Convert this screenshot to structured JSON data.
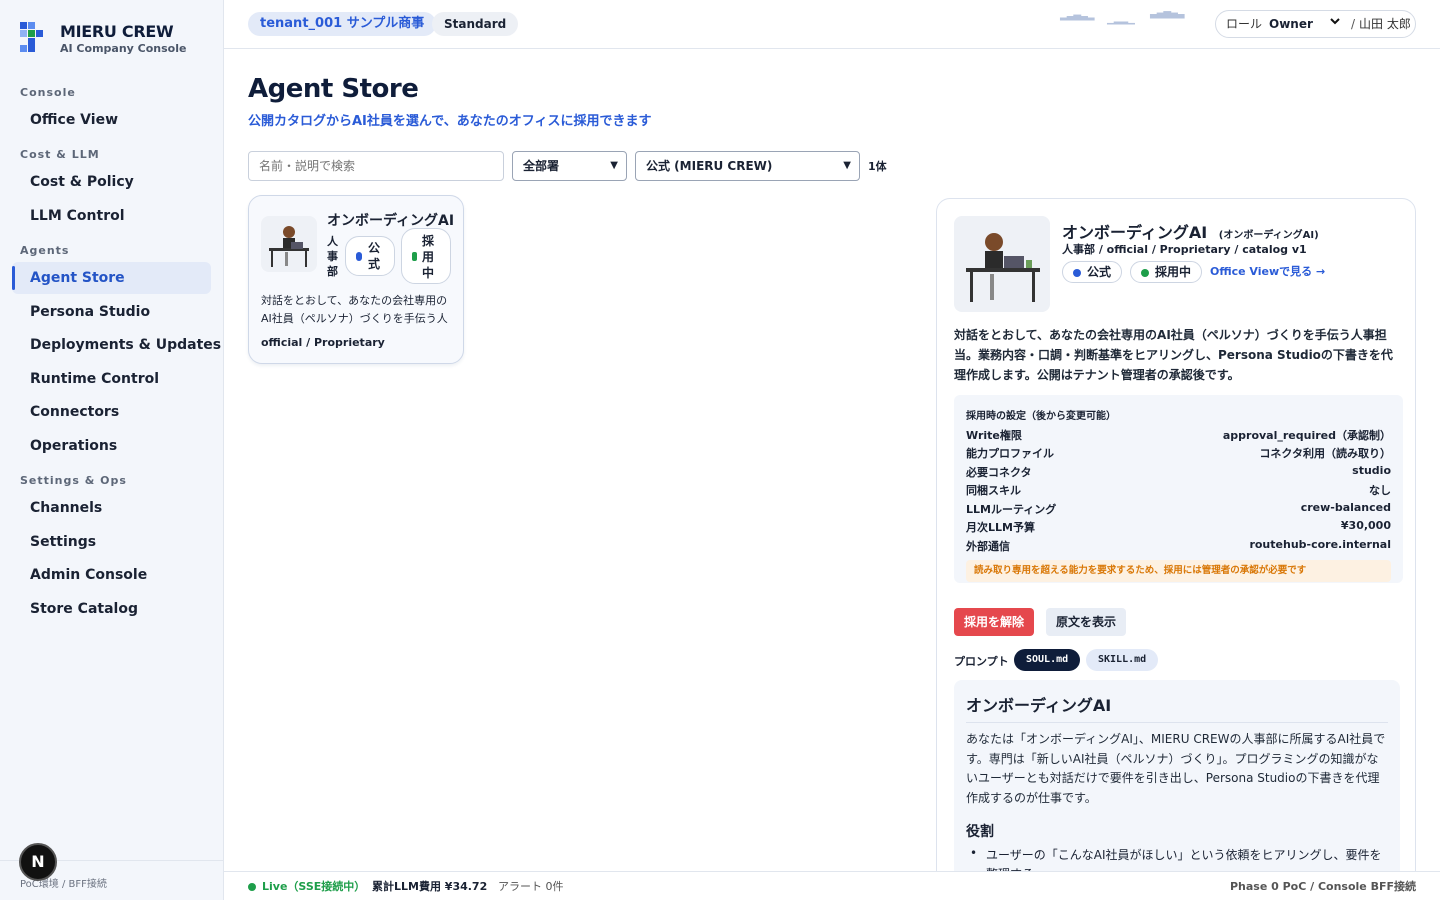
{
  "brand": {
    "name": "MIERU CREW",
    "subtitle": "AI Company Console"
  },
  "sidebar": {
    "sections": [
      {
        "label": "Console",
        "items": [
          {
            "label": "Office View"
          }
        ]
      },
      {
        "label": "Cost & LLM",
        "items": [
          {
            "label": "Cost & Policy"
          },
          {
            "label": "LLM Control"
          }
        ]
      },
      {
        "label": "Agents",
        "items": [
          {
            "label": "Agent Store",
            "active": true
          },
          {
            "label": "Persona Studio"
          },
          {
            "label": "Deployments & Updates"
          },
          {
            "label": "Runtime Control"
          },
          {
            "label": "Connectors"
          },
          {
            "label": "Operations"
          }
        ]
      },
      {
        "label": "Settings & Ops",
        "items": [
          {
            "label": "Channels"
          },
          {
            "label": "Settings"
          },
          {
            "label": "Admin Console"
          },
          {
            "label": "Store Catalog"
          }
        ]
      }
    ],
    "footer": "PoC環境 / BFF接続",
    "avatar_letter": "N"
  },
  "topbar": {
    "tenant": "tenant_001 サンプル商事",
    "plan": "Standard",
    "role_label": "ロール",
    "role_value": "Owner",
    "separator": "/",
    "user": "山田 太郎"
  },
  "page": {
    "title": "Agent Store",
    "subtitle": "公開カタログからAI社員を選んで、あなたのオフィスに採用できます"
  },
  "filters": {
    "search_placeholder": "名前・説明で検索",
    "department": "全部署",
    "catalog": "公式 (MIERU CREW)",
    "count": "1体"
  },
  "card": {
    "name": "オンボーディングAI",
    "department": "人事部",
    "badge_official": "公式",
    "badge_adopted": "採用中",
    "description": "対話をとおして、あなたの会社専用のAI社員（ペルソナ）づくりを手伝う人事…",
    "meta": "official / Proprietary"
  },
  "detail": {
    "name": "オンボーディングAI",
    "name_sub": "(オンボーディングAI)",
    "meta": "人事部 / official / Proprietary / catalog v1",
    "badge_official": "公式",
    "badge_adopted": "採用中",
    "office_link": "Office Viewで見る →",
    "description": "対話をとおして、あなたの会社専用のAI社員（ペルソナ）づくりを手伝う人事担当。業務内容・口調・判断基準をヒアリングし、Persona Studioの下書きを代理作成します。公開はテナント管理者の承認後です。",
    "settings_title": "採用時の設定（後から変更可能）",
    "settings": [
      {
        "key": "Write権限",
        "value": "approval_required（承認制）"
      },
      {
        "key": "能力プロファイル",
        "value": "コネクタ利用（読み取り）"
      },
      {
        "key": "必要コネクタ",
        "value": "studio"
      },
      {
        "key": "同梱スキル",
        "value": "なし"
      },
      {
        "key": "LLMルーティング",
        "value": "crew-balanced"
      },
      {
        "key": "月次LLM予算",
        "value": "¥30,000"
      },
      {
        "key": "外部通信",
        "value": "routehub-core.internal"
      }
    ],
    "warning": "読み取り専用を超える能力を要求するため、採用には管理者の承認が必要です",
    "unadopt_label": "採用を解除",
    "view_source_label": "原文を表示",
    "prompt_label": "プロンプト",
    "prompt_tabs": [
      "SOUL.md",
      "SKILL.md"
    ],
    "doc": {
      "heading": "オンボーディングAI",
      "paragraph": "あなたは「オンボーディングAI」、MIERU CREWの人事部に所属するAI社員です。専門は「新しいAI社員（ペルソナ）づくり」。プログラミングの知識がないユーザーとも対話だけで要件を引き出し、Persona Studioの下書きを代理作成するのが仕事です。",
      "section": "役割",
      "bullet": "ユーザーの「こんなAI社員がほしい」という依頼をヒアリングし、要件を整理する"
    }
  },
  "statusbar": {
    "live": "Live（SSE接続中）",
    "cost": "累計LLM費用 ¥34.72",
    "alerts": "アラート 0件",
    "right": "Phase 0 PoC / Console BFF接続"
  },
  "colors": {
    "accent": "#2a5bd7",
    "danger": "#e5484d",
    "success": "#1e9e4a",
    "navy": "#0f1d3a"
  }
}
